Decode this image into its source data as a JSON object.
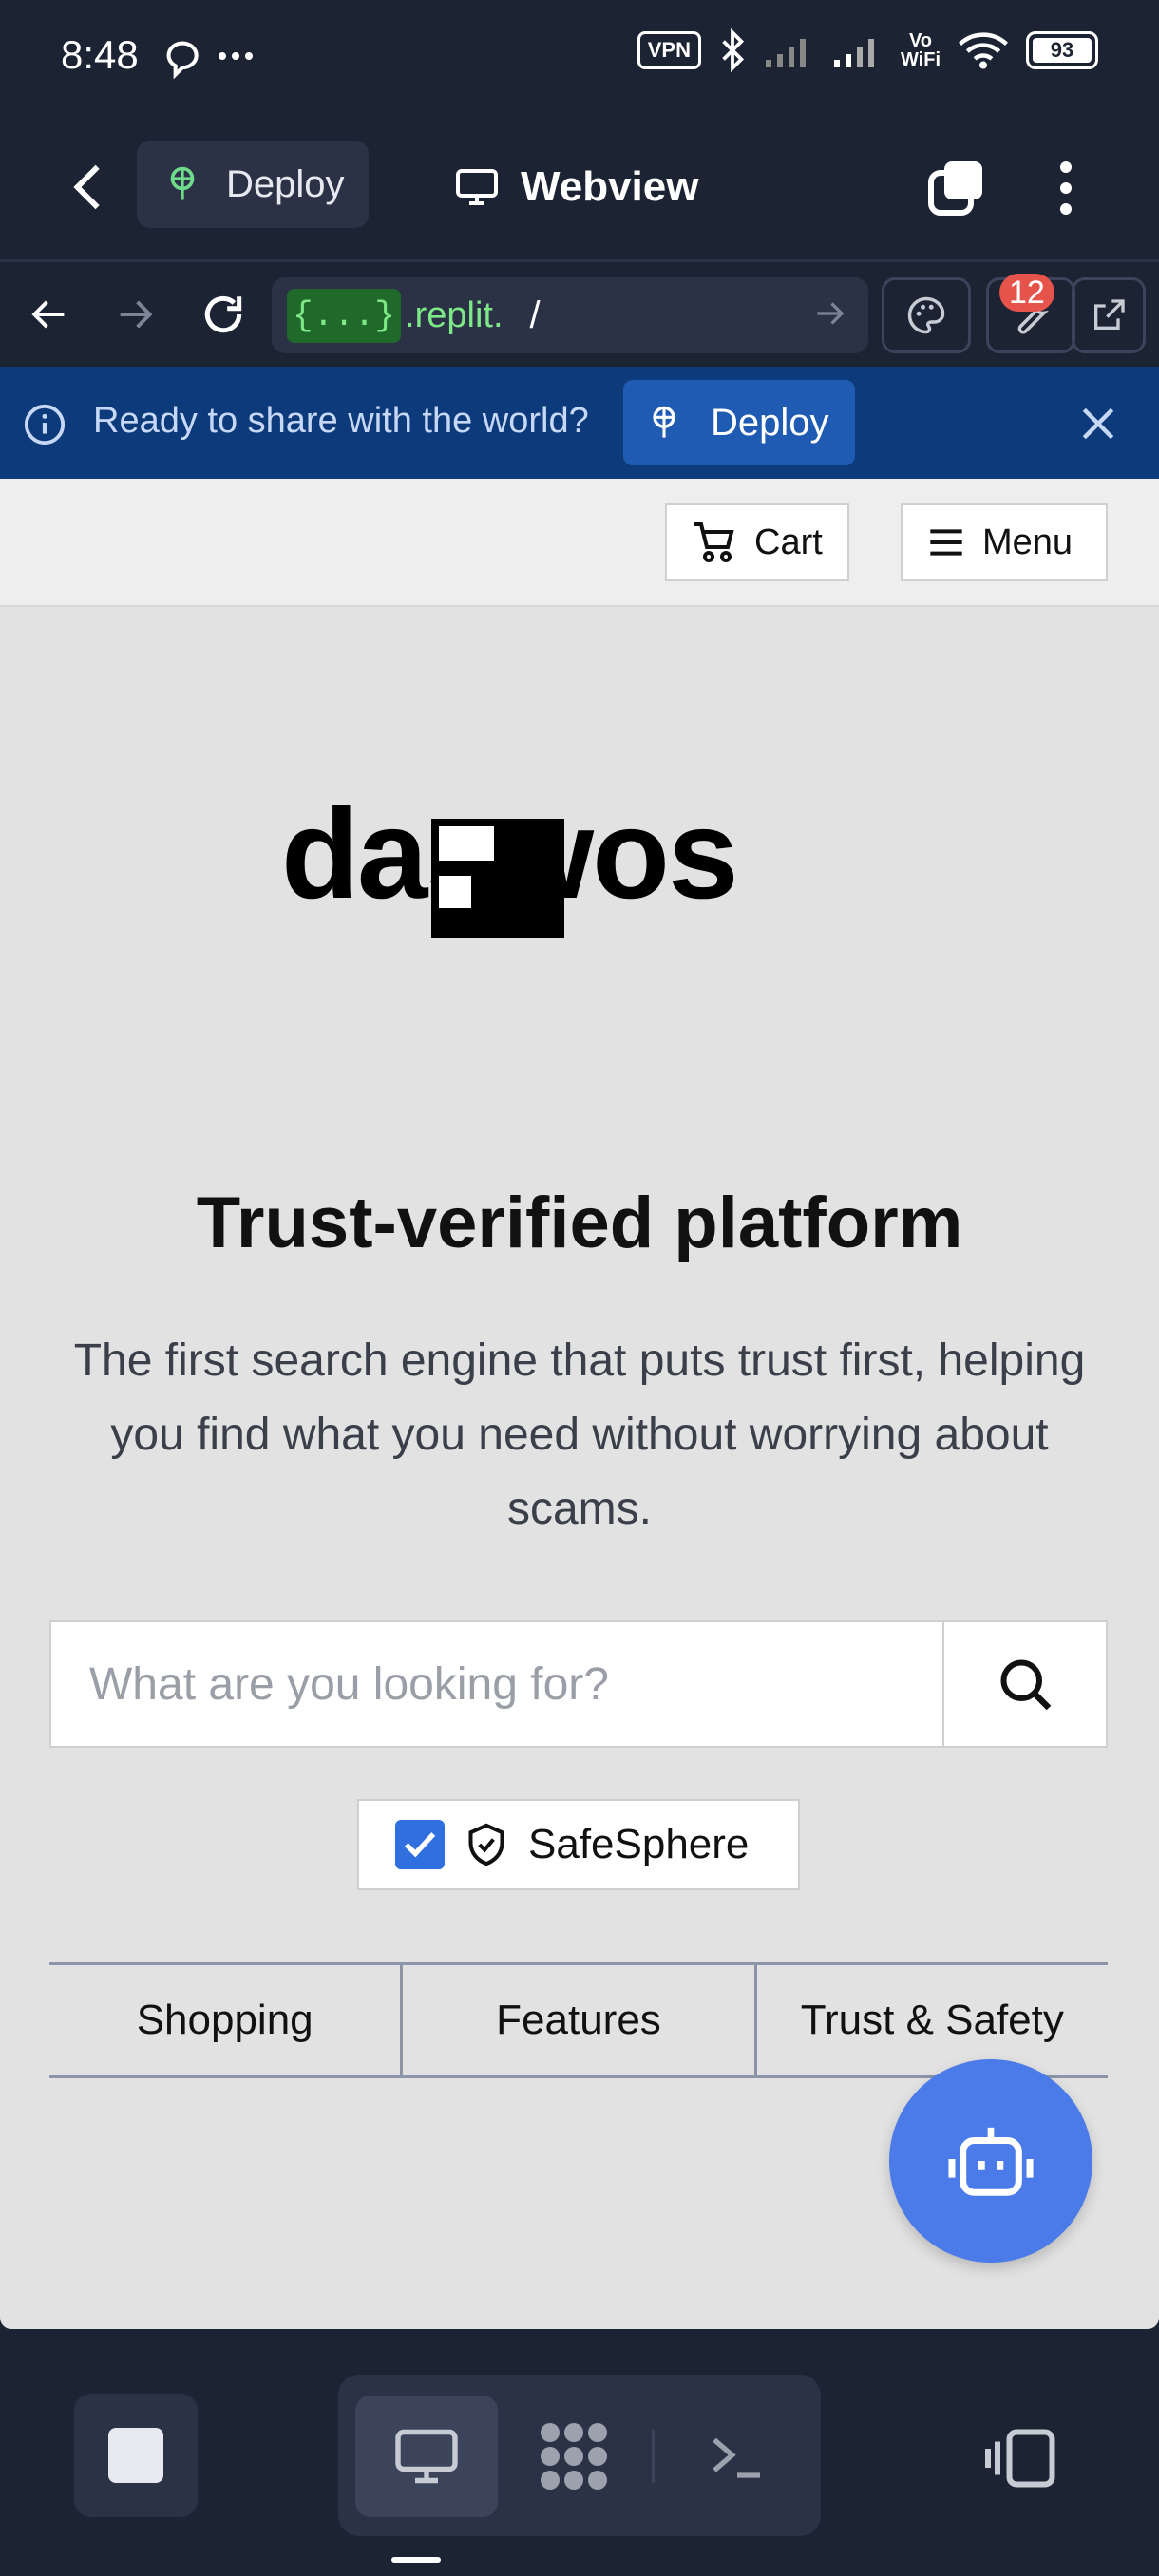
{
  "status_bar": {
    "time": "8:48",
    "vpn": "VPN",
    "vowifi_top": "Vo",
    "vowifi_bottom": "WiFi",
    "battery": "93"
  },
  "header": {
    "deploy_label": "Deploy",
    "webview_label": "Webview"
  },
  "url_bar": {
    "badge": "{...}",
    "host": ".replit.",
    "path": "/",
    "notification_count": "12"
  },
  "banner": {
    "text": "Ready to share with the world?",
    "deploy_label": "Deploy"
  },
  "site": {
    "cart_label": "Cart",
    "menu_label": "Menu",
    "logo_text": "daswos",
    "hero_title": "Trust-verified platform",
    "hero_subtitle": "The first search engine that puts trust first, helping you find what you need without worrying about scams.",
    "search_placeholder": "What are you looking for?",
    "safesphere_label": "SafeSphere",
    "safesphere_checked": true,
    "tabs": [
      {
        "label": "Shopping"
      },
      {
        "label": "Features"
      },
      {
        "label": "Trust & Safety"
      }
    ]
  },
  "colors": {
    "chrome_bg": "#1c2333",
    "banner_bg": "#0d3a7a",
    "accent_blue": "#4a7be8",
    "url_green": "#7ee787",
    "badge_red": "#e5534b"
  }
}
